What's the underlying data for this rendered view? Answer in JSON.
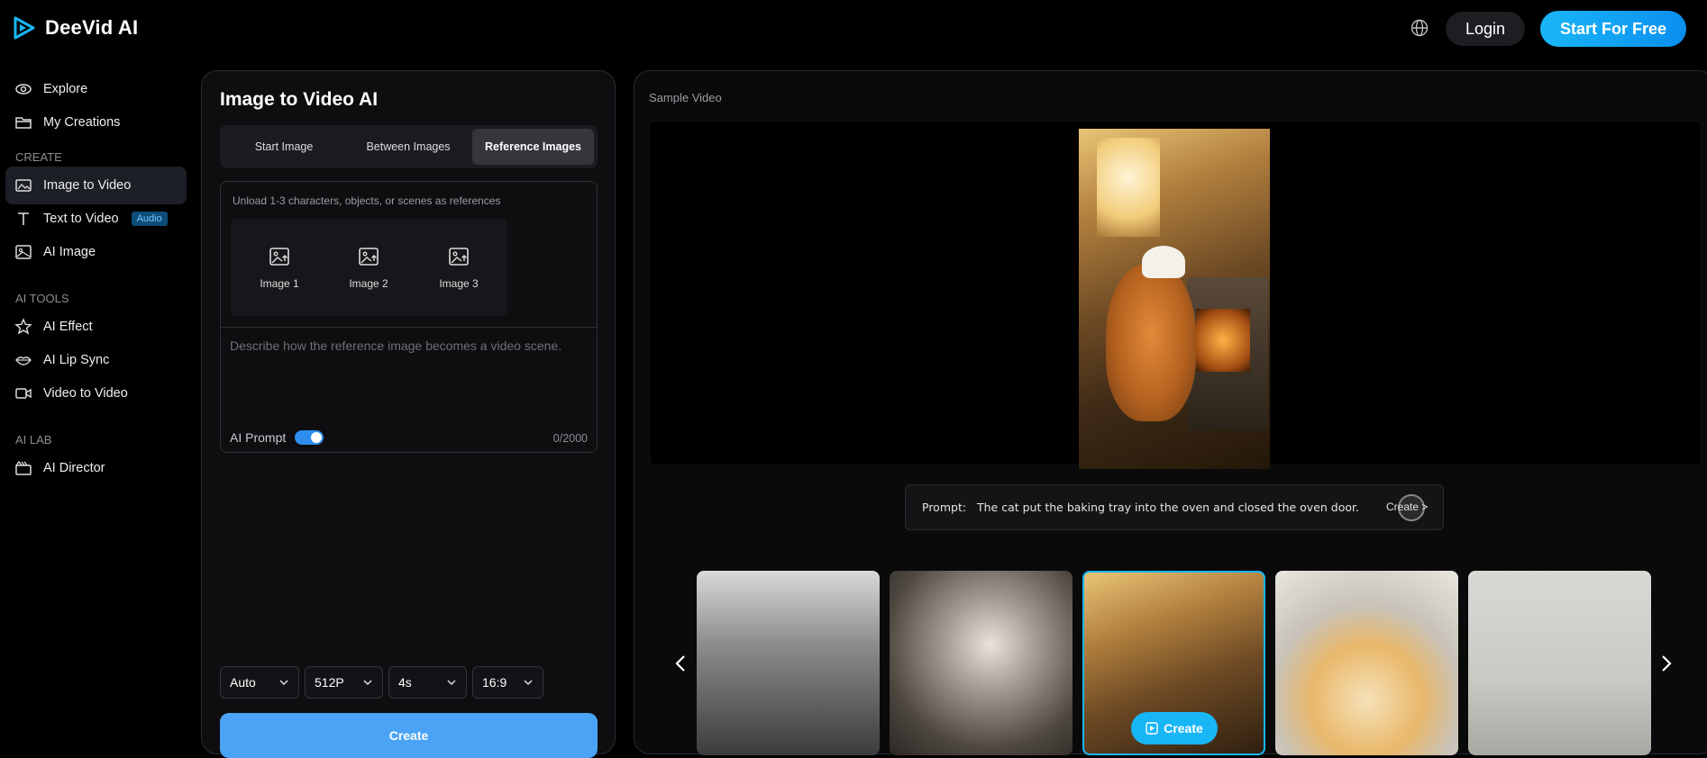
{
  "brand": {
    "name": "DeeVid AI"
  },
  "header": {
    "login_label": "Login",
    "start_label": "Start For Free"
  },
  "sidebar": {
    "top_items": [
      {
        "label": "Explore",
        "icon": "eye-icon"
      },
      {
        "label": "My Creations",
        "icon": "folder-icon"
      }
    ],
    "create_section": "CREATE",
    "create_items": [
      {
        "label": "Image to Video",
        "icon": "image-icon",
        "active": true
      },
      {
        "label": "Text to Video",
        "icon": "text-icon",
        "badge": "Audio"
      },
      {
        "label": "AI Image",
        "icon": "gallery-icon"
      }
    ],
    "tools_section": "AI TOOLS",
    "tools_items": [
      {
        "label": "AI Effect",
        "icon": "star-icon"
      },
      {
        "label": "AI Lip Sync",
        "icon": "lips-icon"
      },
      {
        "label": "Video to Video",
        "icon": "camera-icon"
      }
    ],
    "lab_section": "AI LAB",
    "lab_items": [
      {
        "label": "AI Director",
        "icon": "director-icon"
      }
    ]
  },
  "panel": {
    "title": "Image to Video AI",
    "tabs": [
      "Start Image",
      "Between Images",
      "Reference Images"
    ],
    "active_tab": "Reference Images",
    "ref_hint": "Unload 1-3 characters, objects, or scenes as references",
    "slots": [
      "Image 1",
      "Image 2",
      "Image 3"
    ],
    "prompt_placeholder": "Describe how the reference image becomes a video scene.",
    "ai_prompt_label": "AI Prompt",
    "ai_prompt_enabled": true,
    "counter": "0/2000",
    "selects": [
      "Auto",
      "512P",
      "4s",
      "16:9"
    ],
    "create_label": "Create"
  },
  "sample": {
    "label": "Sample Video",
    "prompt_prefix": "Prompt:",
    "prompt_text": "The cat put the baking tray into the oven and closed the oven door.",
    "prompt_create": "Create >",
    "thumb_create_label": "Create"
  },
  "colors": {
    "accent": "#19b6f6",
    "create_button": "#4aa3f5",
    "background": "#000000"
  }
}
